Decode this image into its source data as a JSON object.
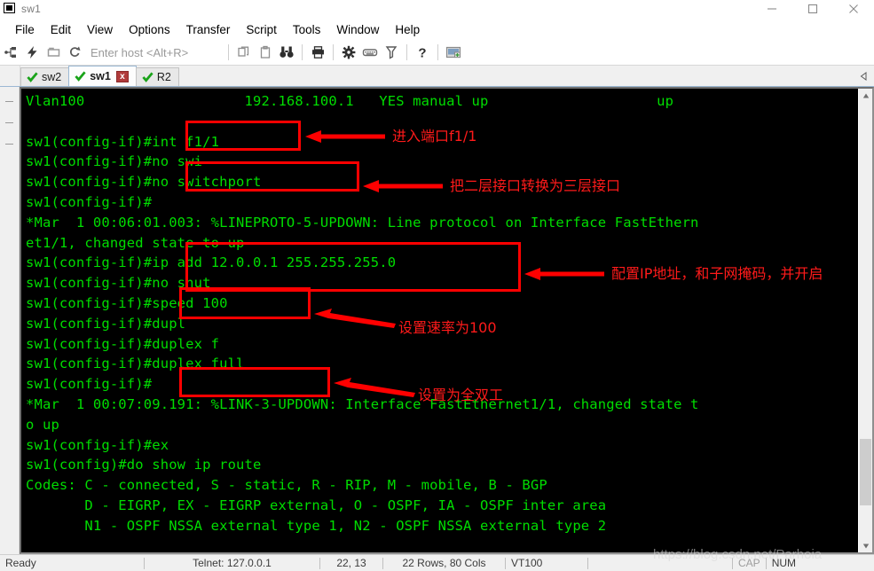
{
  "window": {
    "title": "sw1",
    "icon": "app-window-icon",
    "controls": [
      {
        "name": "minimize-button",
        "glyph": "minimize"
      },
      {
        "name": "maximize-button",
        "glyph": "maximize"
      },
      {
        "name": "close-button",
        "glyph": "close"
      }
    ]
  },
  "menubar": {
    "items": [
      {
        "label": "File"
      },
      {
        "label": "Edit"
      },
      {
        "label": "View"
      },
      {
        "label": "Options"
      },
      {
        "label": "Transfer"
      },
      {
        "label": "Script"
      },
      {
        "label": "Tools"
      },
      {
        "label": "Window"
      },
      {
        "label": "Help"
      }
    ]
  },
  "toolbar": {
    "host_placeholder": "Enter host <Alt+R>",
    "buttons": [
      {
        "name": "connect-icon",
        "tooltip": "Connect"
      },
      {
        "name": "quick-connect-icon",
        "tooltip": "Quick Connect"
      },
      {
        "name": "connect-in-tab-icon",
        "tooltip": "Connect in Tab"
      },
      {
        "name": "reconnect-icon",
        "tooltip": "Reconnect"
      },
      {
        "name": "copy-icon",
        "tooltip": "Copy"
      },
      {
        "name": "paste-icon",
        "tooltip": "Paste"
      },
      {
        "name": "find-icon",
        "tooltip": "Find"
      },
      {
        "name": "print-icon",
        "tooltip": "Print"
      },
      {
        "name": "session-options-icon",
        "tooltip": "Session Options"
      },
      {
        "name": "keymap-editor-icon",
        "tooltip": "Keymap Editor"
      },
      {
        "name": "filter-icon",
        "tooltip": "Filter"
      },
      {
        "name": "help-icon",
        "tooltip": "Help"
      },
      {
        "name": "new-session-icon",
        "tooltip": "New Session"
      }
    ]
  },
  "tabs": {
    "items": [
      {
        "label": "sw2",
        "active": false,
        "status": "connected"
      },
      {
        "label": "sw1",
        "active": true,
        "status": "connected",
        "close_label": "x"
      },
      {
        "label": "R2",
        "active": false,
        "status": "connected"
      }
    ]
  },
  "terminal": {
    "fg_color": "#00dd00",
    "bg_color": "#000000",
    "lines": [
      "Vlan100                   192.168.100.1   YES manual up                    up",
      "",
      "sw1(config-if)#int f1/1",
      "sw1(config-if)#no swi",
      "sw1(config-if)#no switchport",
      "sw1(config-if)#",
      "*Mar  1 00:06:01.003: %LINEPROTO-5-UPDOWN: Line protocol on Interface FastEthern",
      "et1/1, changed state to up",
      "sw1(config-if)#ip add 12.0.0.1 255.255.255.0",
      "sw1(config-if)#no shut",
      "sw1(config-if)#speed 100",
      "sw1(config-if)#dupl",
      "sw1(config-if)#duplex f",
      "sw1(config-if)#duplex full",
      "sw1(config-if)#",
      "*Mar  1 00:07:09.191: %LINK-3-UPDOWN: Interface FastEthernet1/1, changed state t",
      "o up",
      "sw1(config-if)#ex",
      "sw1(config)#do show ip route",
      "Codes: C - connected, S - static, R - RIP, M - mobile, B - BGP",
      "       D - EIGRP, EX - EIGRP external, O - OSPF, IA - OSPF inter area",
      "       N1 - OSPF NSSA external type 1, N2 - OSPF NSSA external type 2"
    ]
  },
  "annotations": {
    "color": "#ff0000",
    "labels": [
      {
        "name": "annotation-enter-port",
        "text": "进入端口f1/1"
      },
      {
        "name": "annotation-l2-to-l3",
        "text": "把二层接口转换为三层接口"
      },
      {
        "name": "annotation-ip-config",
        "text": "配置IP地址，和子网掩码，并开启"
      },
      {
        "name": "annotation-speed",
        "text": "设置速率为100"
      },
      {
        "name": "annotation-duplex",
        "text": "设置为全双工"
      }
    ]
  },
  "watermark": {
    "text": "https://blog.csdn.net/Parhoia"
  },
  "statusbar": {
    "ready": "Ready",
    "connection": "Telnet: 127.0.0.1",
    "cursor": "22, 13",
    "size": "22 Rows, 80 Cols",
    "emulation": "VT100",
    "blank": "",
    "cap": "CAP",
    "num": "NUM"
  }
}
